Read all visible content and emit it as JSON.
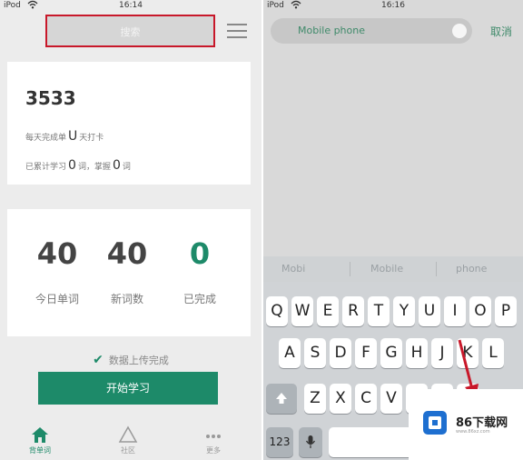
{
  "left": {
    "status": {
      "carrier": "iPod",
      "time": "16:14"
    },
    "search_placeholder": "搜索",
    "summary": {
      "word_count": "3533",
      "plan_line_prefix": "每天完成单",
      "plan_u": "U",
      "plan_line_suffix": "天打卡",
      "progress_prefix": "已累计学习",
      "learned": "0",
      "learned_unit": "词，掌握",
      "mastered": "0",
      "mastered_unit": "词"
    },
    "stats": [
      {
        "value": "40",
        "label": "今日单词"
      },
      {
        "value": "40",
        "label": "新词数"
      },
      {
        "value": "0",
        "label": "已完成"
      }
    ],
    "sync_text": "数据上传完成",
    "start_button": "开始学习",
    "tabs": [
      {
        "label": "背单词"
      },
      {
        "label": "社区"
      },
      {
        "label": "更多"
      }
    ],
    "colors": {
      "accent": "#1d8a69",
      "highlight": "#c8182a"
    }
  },
  "right": {
    "status": {
      "carrier": "iPod",
      "time": "16:16"
    },
    "search_value": "Mobile phone",
    "cancel": "取消",
    "predictions": [
      "Mobi",
      "Mobile",
      "phone"
    ],
    "keyboard": {
      "row1": [
        "Q",
        "W",
        "E",
        "R",
        "T",
        "Y",
        "U",
        "I",
        "O",
        "P"
      ],
      "row2": [
        "A",
        "S",
        "D",
        "F",
        "G",
        "H",
        "J",
        "K",
        "L"
      ],
      "row3": [
        "Z",
        "X",
        "C",
        "V",
        "B",
        "N",
        "M"
      ],
      "numbers_key": "123"
    }
  },
  "watermark": {
    "brand": "86下载网",
    "url": "www.86xz.com"
  }
}
